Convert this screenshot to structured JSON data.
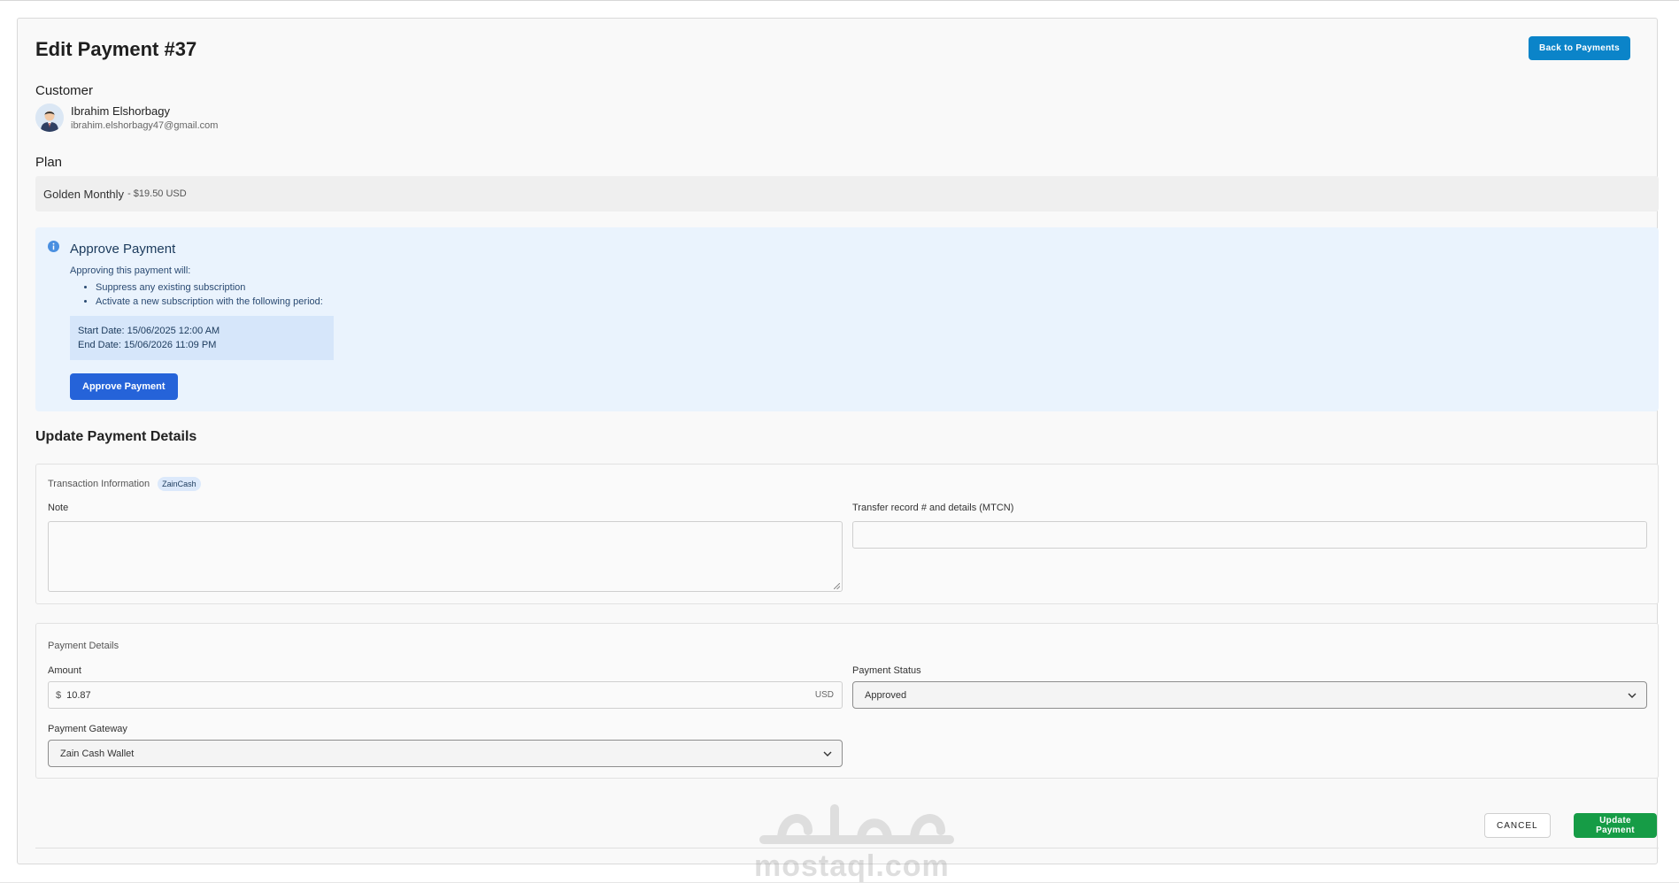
{
  "header": {
    "title": "Edit Payment #37",
    "back_label": "Back to Payments"
  },
  "customer": {
    "label": "Customer",
    "name": "Ibrahim Elshorbagy",
    "email": "ibrahim.elshorbagy47@gmail.com"
  },
  "plan": {
    "label": "Plan",
    "name": "Golden Monthly",
    "price": "- $19.50 USD"
  },
  "approve": {
    "title": "Approve Payment",
    "description": "Approving this payment will:",
    "bullets": [
      "Suppress any existing subscription",
      "Activate a new subscription with the following period:"
    ],
    "start_date": "Start Date: 15/06/2025 12:00 AM",
    "end_date": "End Date: 15/06/2026 11:09 PM",
    "button_label": "Approve Payment"
  },
  "update_section": {
    "title": "Update Payment Details"
  },
  "transaction": {
    "legend": "Transaction Information",
    "gateway_chip": "ZainCash",
    "note_label": "Note",
    "note_value": "",
    "mtcn_label": "Transfer record # and details (MTCN)",
    "mtcn_value": ""
  },
  "payment_details": {
    "legend": "Payment Details",
    "amount_label": "Amount",
    "amount_prefix": "$",
    "amount_value": "10.87",
    "amount_suffix": "USD",
    "status_label": "Payment Status",
    "status_value": "Approved",
    "gateway_label": "Payment Gateway",
    "gateway_value": "Zain Cash Wallet"
  },
  "actions": {
    "cancel_label": "CANCEL",
    "update_label": "Update Payment"
  },
  "watermark": {
    "url": "mostaql.com"
  },
  "colors": {
    "primary_blue": "#0b84c9",
    "approve_blue": "#2563d9",
    "success_green": "#169c46",
    "info_bg": "#eaf3fd"
  }
}
